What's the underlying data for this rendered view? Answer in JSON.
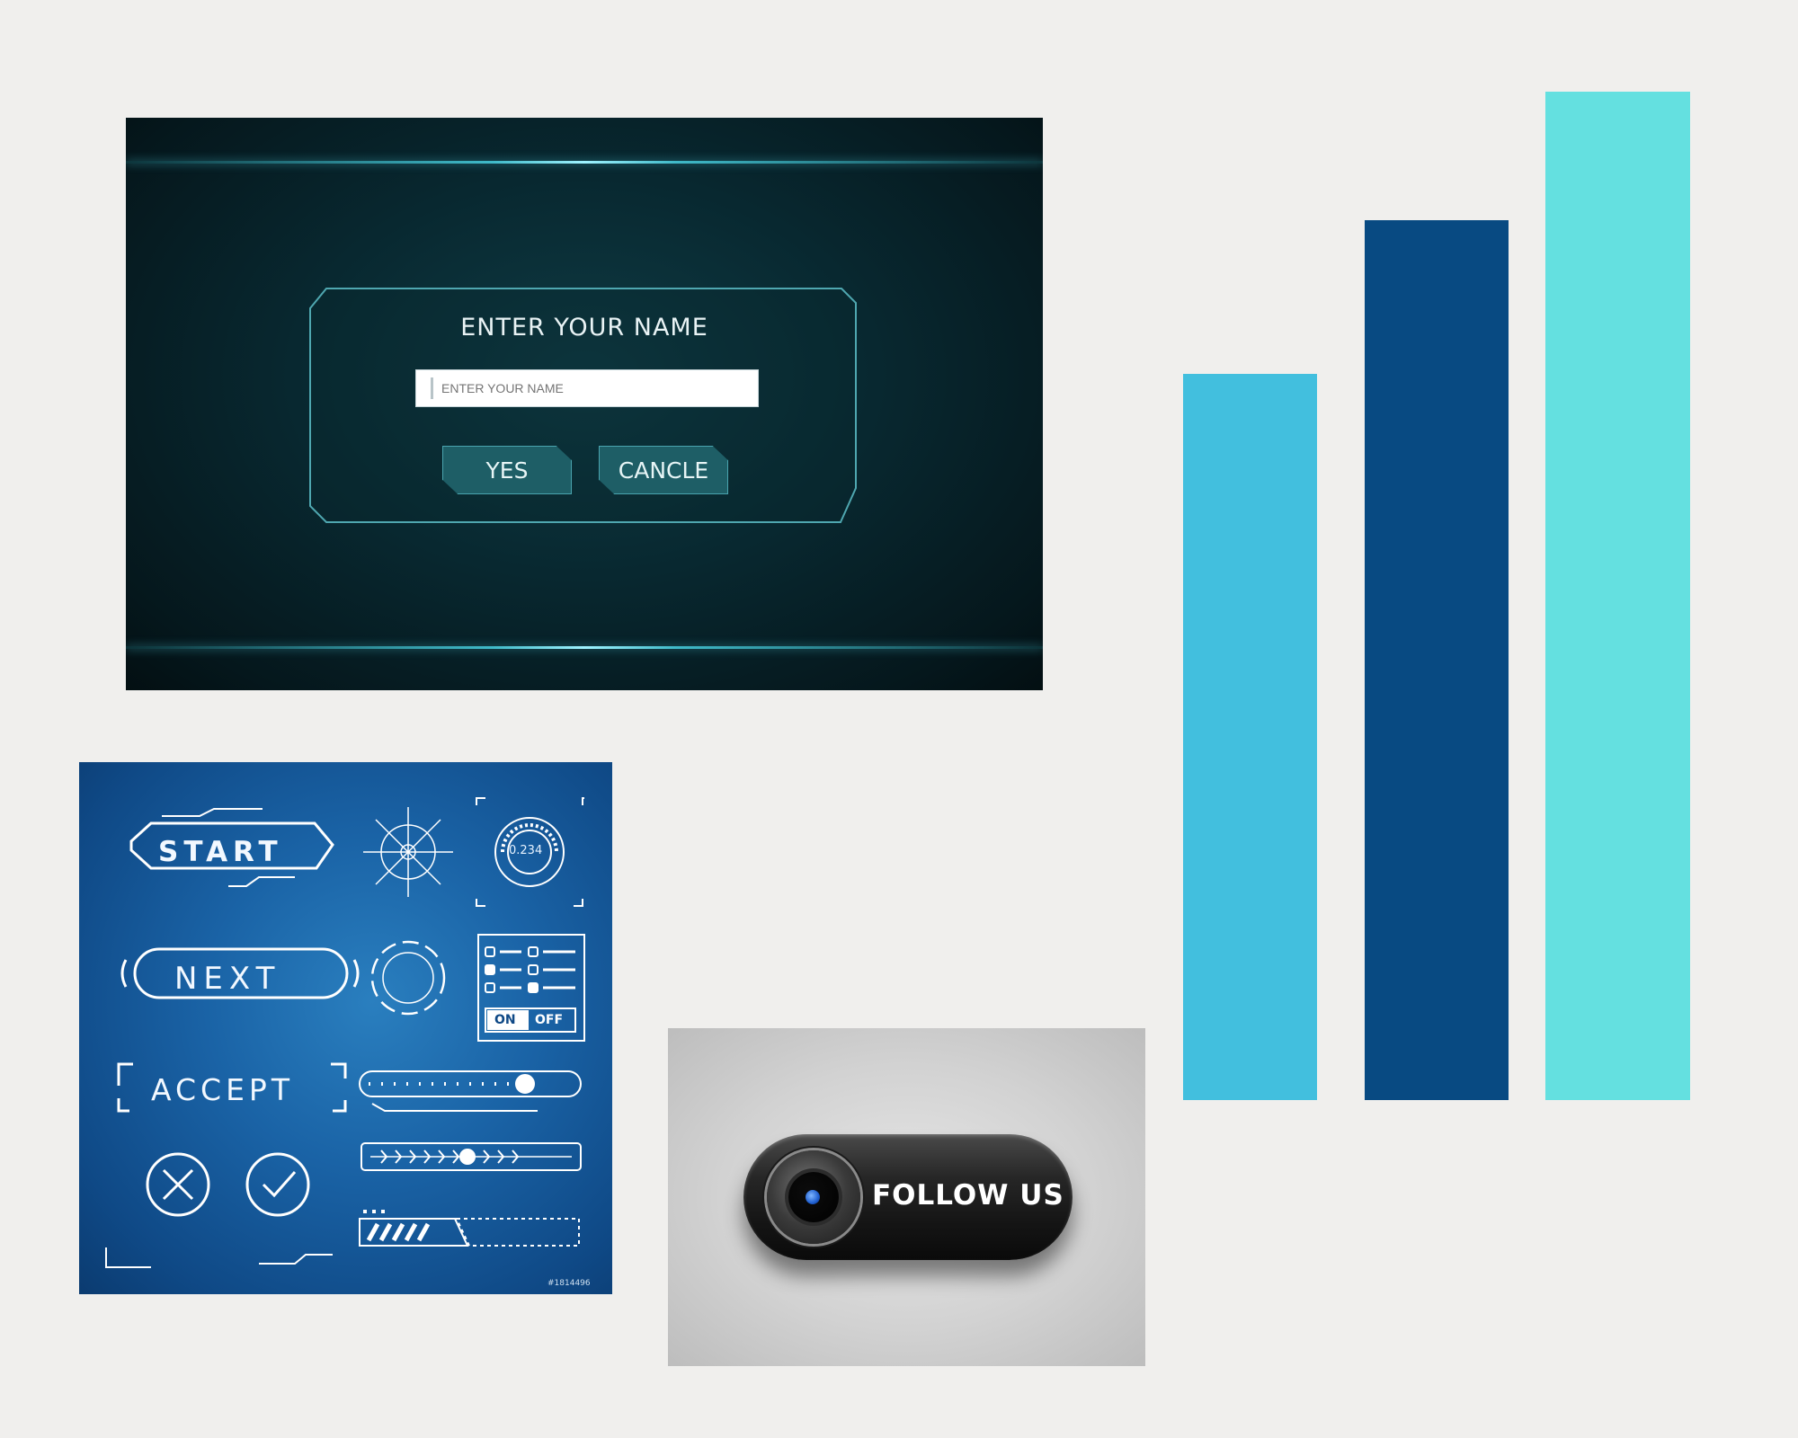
{
  "dialog": {
    "title": "ENTER YOUR NAME",
    "input_placeholder": "ENTER YOUR NAME",
    "input_value": "",
    "yes_label": "YES",
    "cancel_label": "CANCLE"
  },
  "bars": {
    "colors": [
      "#42bfde",
      "#084a82",
      "#64e0e0"
    ]
  },
  "hud_kit": {
    "start_label": "START",
    "next_label": "NEXT",
    "accept_label": "ACCEPT",
    "gauge_readout": "0.234",
    "toggle_on_label": "ON",
    "toggle_off_label": "OFF",
    "image_id_text": "#1814496",
    "icons": [
      "close-circle-icon",
      "check-circle-icon",
      "radar-target-icon",
      "dashed-ring-icon",
      "gauge-icon"
    ],
    "colors": {
      "background": "#1a63a6",
      "line": "#ffffff"
    }
  },
  "follow": {
    "label": "FOLLOW US",
    "icon": "camera-lens-icon"
  }
}
